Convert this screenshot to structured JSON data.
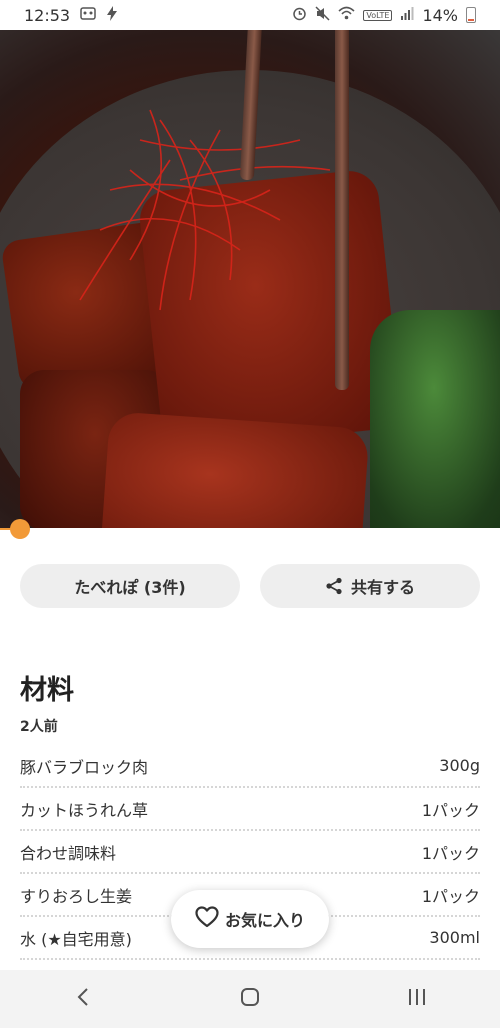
{
  "status_bar": {
    "time": "12:53",
    "battery": "14%",
    "left_icons": [
      "gallery-icon",
      "flash-icon"
    ],
    "right_icons": [
      "alarm-icon",
      "mute-icon",
      "wifi-icon",
      "volte-icon",
      "signal-icon",
      "battery-icon"
    ],
    "volte_label": "VoLTE"
  },
  "video": {
    "progress": 0.04,
    "accent": "#f29a38"
  },
  "actions": {
    "tabereport_label": "たべれぽ (3件)",
    "share_label": "共有する"
  },
  "ingredients": {
    "title": "材料",
    "servings": "2人前",
    "items": [
      {
        "name": "豚バラブロック肉",
        "amount": "300g"
      },
      {
        "name": "カットほうれん草",
        "amount": "1パック"
      },
      {
        "name": "合わせ調味料",
        "amount": "1パック"
      },
      {
        "name": "すりおろし生姜",
        "amount": "1パック"
      },
      {
        "name": "水 (★自宅用意)",
        "amount": "300ml"
      }
    ]
  },
  "favorite": {
    "label": "お気に入り"
  },
  "nav": {
    "buttons": [
      "back-icon",
      "home-icon",
      "recent-apps-icon"
    ]
  }
}
